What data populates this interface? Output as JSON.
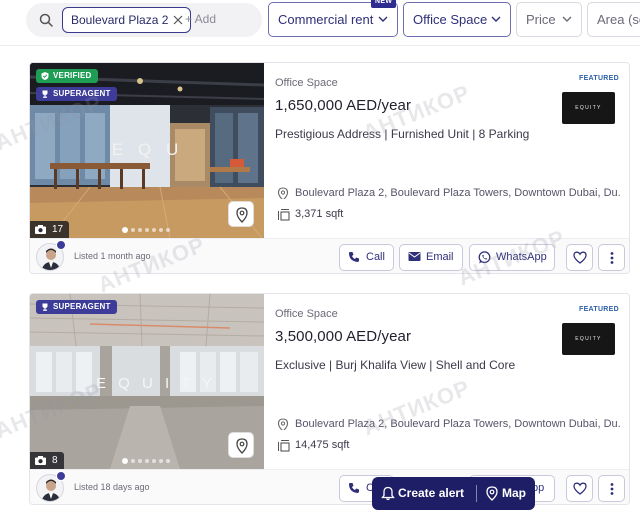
{
  "filters": {
    "chip_label": "Boulevard Plaza 2",
    "add_label": "+ Add",
    "category_label": "Commercial rent",
    "new_badge": "NEW",
    "subtype_label": "Office Space",
    "price_label": "Price",
    "area_label": "Area (sq"
  },
  "listings": [
    {
      "verified_label": "VERIFIED",
      "superagent_label": "SUPERAGENT",
      "photo_count": "17",
      "photo_sign": "E Q U",
      "type": "Office Space",
      "price": "1,650,000 AED/year",
      "description": "Prestigious Address | Furnished Unit | 8 Parking",
      "featured": "FEATURED",
      "logo_text": "EQUITY",
      "address": "Boulevard Plaza 2, Boulevard Plaza Towers, Downtown Dubai, Du...",
      "area": "3,371 sqft",
      "listed": "Listed 1 month ago",
      "call_label": "Call",
      "email_label": "Email",
      "whatsapp_label": "WhatsApp"
    },
    {
      "superagent_label": "SUPERAGENT",
      "photo_count": "8",
      "photo_sign": "E Q U I T Y",
      "type": "Office Space",
      "price": "3,500,000 AED/year",
      "description": "Exclusive | Burj Khalifa View | Shell and Core",
      "featured": "FEATURED",
      "logo_text": "EQUITY",
      "address": "Boulevard Plaza 2, Boulevard Plaza Towers, Downtown Dubai, Du...",
      "area": "14,475 sqft",
      "listed": "Listed 18 days ago",
      "call_label": "C",
      "whatsapp_label": "pp"
    }
  ],
  "actions": {
    "create_alert_label": "Create alert",
    "map_label": "Map"
  },
  "watermark": "АНТИКОР",
  "colors": {
    "brand_navy": "#1e1e66",
    "accent_purple": "#3d3d99",
    "verified_green": "#1f9d55",
    "featured_blue": "#2d5fa8"
  }
}
